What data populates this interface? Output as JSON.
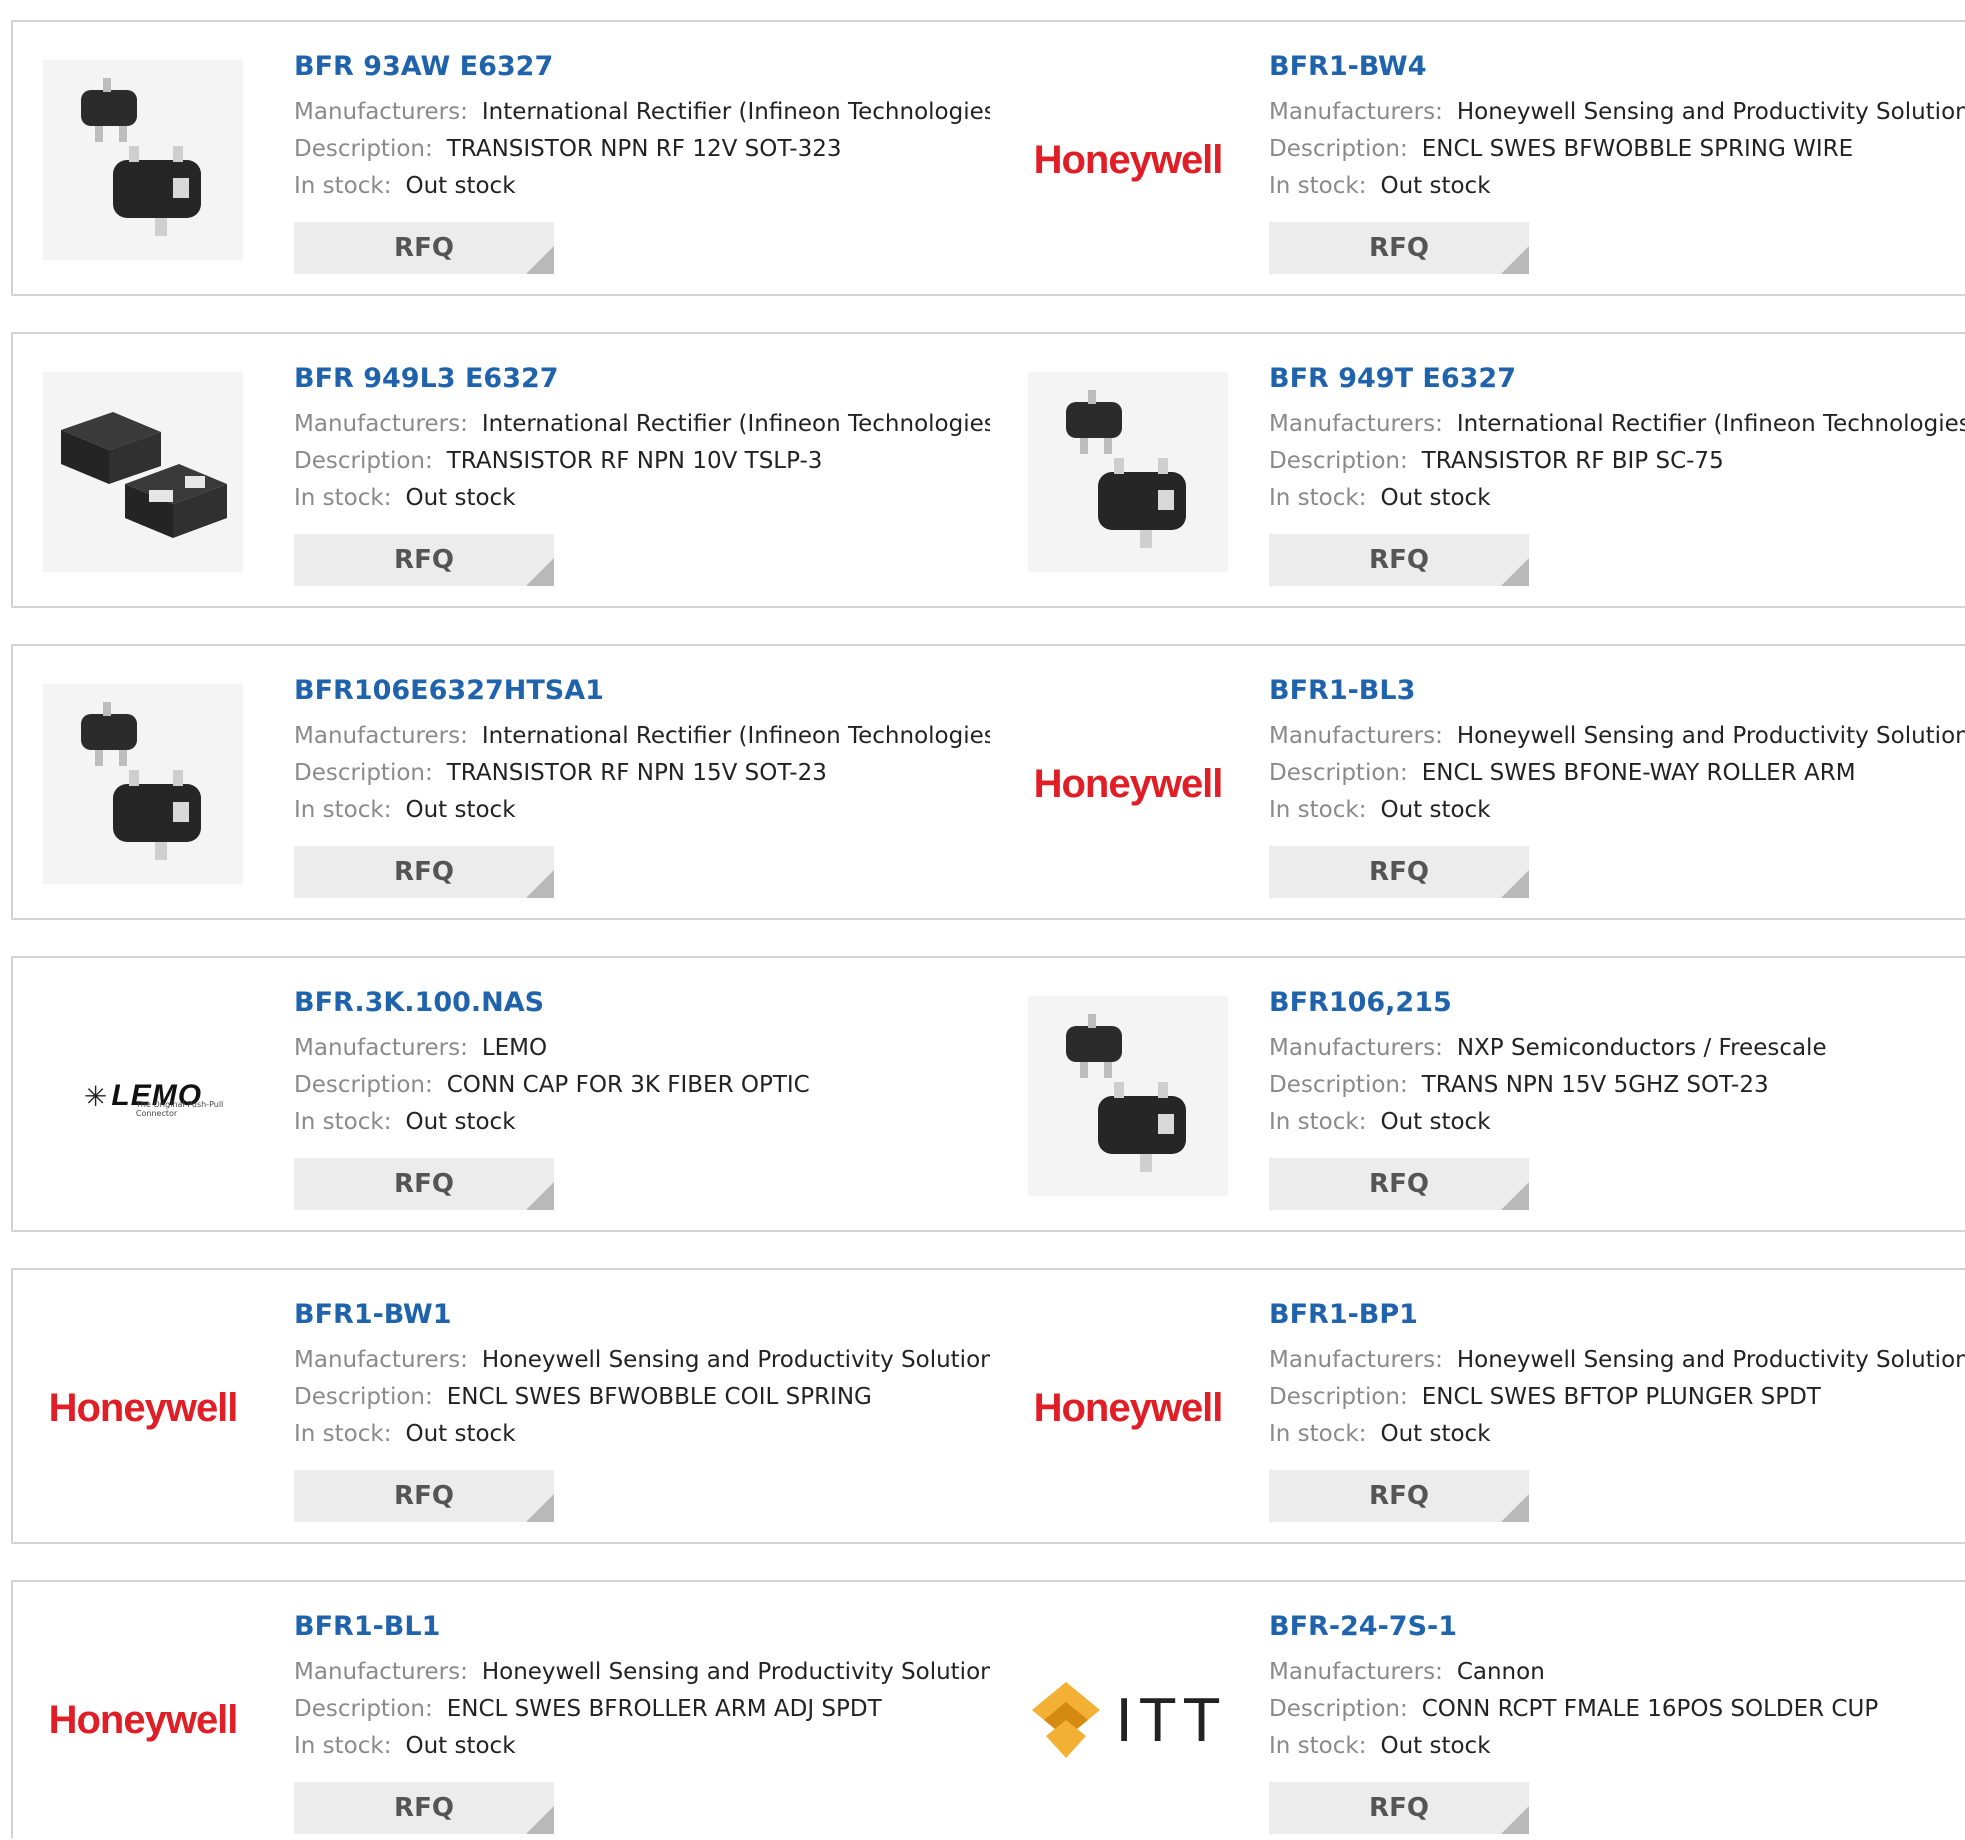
{
  "labels": {
    "manufacturers": "Manufacturers:",
    "description": "Description:",
    "in_stock": "In stock:",
    "rfq": "RFQ"
  },
  "products": [
    {
      "title": "BFR 93AW E6327",
      "manufacturer": "International Rectifier (Infineon Technologies)",
      "description": "TRANSISTOR NPN RF 12V SOT-323",
      "stock": "Out stock",
      "image": "sot-323-package"
    },
    {
      "title": "BFR1-BW4",
      "manufacturer": "Honeywell Sensing and Productivity Solutions",
      "description": "ENCL SWES BFWOBBLE SPRING WIRE",
      "stock": "Out stock",
      "image": "honeywell-logo"
    },
    {
      "title": "BFR 949L3 E6327",
      "manufacturer": "International Rectifier (Infineon Technologies)",
      "description": "TRANSISTOR RF NPN 10V TSLP-3",
      "stock": "Out stock",
      "image": "tslp-3-package"
    },
    {
      "title": "BFR 949T E6327",
      "manufacturer": "International Rectifier (Infineon Technologies)",
      "description": "TRANSISTOR RF BIP SC-75",
      "stock": "Out stock",
      "image": "sc-75-package"
    },
    {
      "title": "BFR106E6327HTSA1",
      "manufacturer": "International Rectifier (Infineon Technologies)",
      "description": "TRANSISTOR RF NPN 15V SOT-23",
      "stock": "Out stock",
      "image": "sot-23-package"
    },
    {
      "title": "BFR1-BL3",
      "manufacturer": "Honeywell Sensing and Productivity Solutions",
      "description": "ENCL SWES BFONE-WAY ROLLER ARM",
      "stock": "Out stock",
      "image": "honeywell-logo"
    },
    {
      "title": "BFR.3K.100.NAS",
      "manufacturer": "LEMO",
      "description": "CONN CAP FOR 3K FIBER OPTIC",
      "stock": "Out stock",
      "image": "lemo-logo"
    },
    {
      "title": "BFR106,215",
      "manufacturer": "NXP Semiconductors / Freescale",
      "description": "TRANS NPN 15V 5GHZ SOT-23",
      "stock": "Out stock",
      "image": "sot-23-package"
    },
    {
      "title": "BFR1-BW1",
      "manufacturer": "Honeywell Sensing and Productivity Solutions",
      "description": "ENCL SWES BFWOBBLE COIL SPRING",
      "stock": "Out stock",
      "image": "honeywell-logo"
    },
    {
      "title": "BFR1-BP1",
      "manufacturer": "Honeywell Sensing and Productivity Solutions",
      "description": "ENCL SWES BFTOP PLUNGER SPDT",
      "stock": "Out stock",
      "image": "honeywell-logo"
    },
    {
      "title": "BFR1-BL1",
      "manufacturer": "Honeywell Sensing and Productivity Solutions",
      "description": "ENCL SWES BFROLLER ARM ADJ SPDT",
      "stock": "Out stock",
      "image": "honeywell-logo"
    },
    {
      "title": "BFR-24-7S-1",
      "manufacturer": "Cannon",
      "description": "CONN RCPT FMALE 16POS SOLDER CUP",
      "stock": "Out stock",
      "image": "itt-logo"
    }
  ],
  "logos": {
    "honeywell": "Honeywell",
    "lemo": "LEMO",
    "lemo_tagline": "The Original Push-Pull Connector",
    "itt": "ITT"
  },
  "colors": {
    "title_link": "#1f63ad",
    "honeywell_red": "#e11e26",
    "button_bg": "#ececec",
    "border": "#d3d3d3"
  }
}
